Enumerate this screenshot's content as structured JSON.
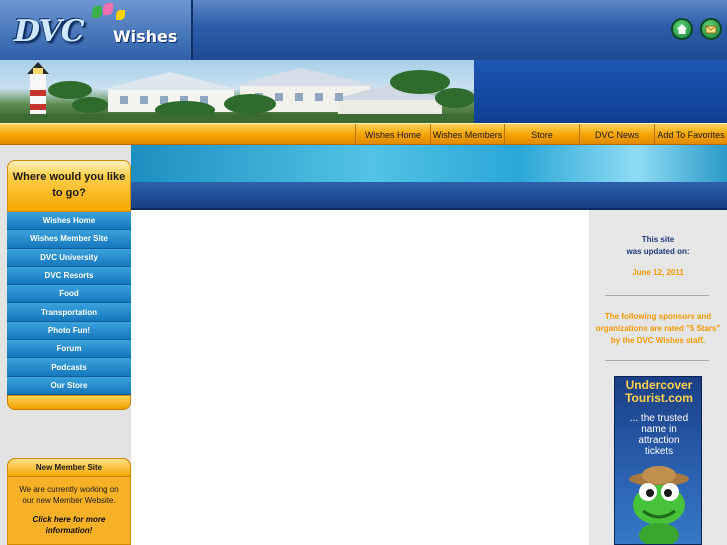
{
  "header": {
    "logo_text": "DVC",
    "logo_suffix": "Wishes",
    "icons": [
      "home-icon",
      "mail-icon"
    ]
  },
  "nav": {
    "items": [
      "Wishes Home",
      "Wishes Members",
      "Store",
      "DVC News",
      "Add To Favorites"
    ]
  },
  "sidebar": {
    "heading": "Where would you like to go?",
    "menu": [
      "Wishes Home",
      "Wishes Member Site",
      "DVC University",
      "DVC Resorts",
      "Food",
      "Transportation",
      "Photo Fun!",
      "Forum",
      "Podcasts",
      "Our Store"
    ],
    "new_member": {
      "title": "New Member Site",
      "body": "We are currently working on our new Member Website.",
      "link": "Click here for more information!"
    }
  },
  "right": {
    "updated_label_1": "This site",
    "updated_label_2": "was updated on:",
    "updated_date": "June 12, 2011",
    "sponsor_text": "The following sponsors and organizations are rated \"5 Stars\" by the DVC Wishes staff."
  },
  "ad": {
    "title_1": "Undercover",
    "title_2": "Tourist.com",
    "sub_1": "... the trusted",
    "sub_2": "name in",
    "sub_3": "attraction",
    "sub_4": "tickets"
  },
  "colors": {
    "nav_orange": "#f5a300",
    "menu_blue": "#1677bd",
    "date_orange": "#f09a00",
    "label_navy": "#1c3b78"
  }
}
